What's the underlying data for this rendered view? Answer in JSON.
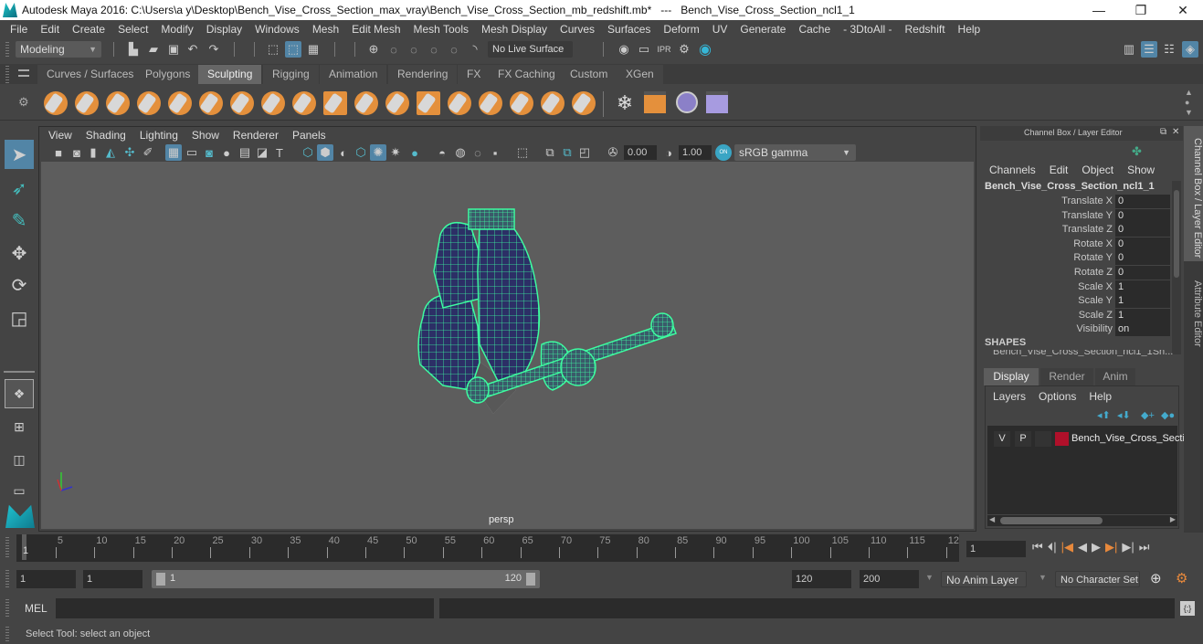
{
  "window": {
    "title": "Autodesk Maya 2016: C:\\Users\\a y\\Desktop\\Bench_Vise_Cross_Section_max_vray\\Bench_Vise_Cross_Section_mb_redshift.mb*   ---   Bench_Vise_Cross_Section_ncl1_1",
    "minimize": "—",
    "maximize": "❐",
    "close": "✕"
  },
  "menubar": [
    "File",
    "Edit",
    "Create",
    "Select",
    "Modify",
    "Display",
    "Windows",
    "Mesh",
    "Edit Mesh",
    "Mesh Tools",
    "Mesh Display",
    "Curves",
    "Surfaces",
    "Deform",
    "UV",
    "Generate",
    "Cache",
    "- 3DtoAll -",
    "Redshift",
    "Help"
  ],
  "statusline": {
    "mode": "Modeling",
    "live_surface": "No Live Surface"
  },
  "shelf": {
    "tabs": [
      "Curves / Surfaces",
      "Polygons",
      "Sculpting",
      "Rigging",
      "Animation",
      "Rendering",
      "FX",
      "FX Caching",
      "Custom",
      "XGen"
    ],
    "active_tab": "Sculpting",
    "icons": [
      "sculpt-tool",
      "smooth-tool",
      "relax-tool",
      "grab-tool",
      "pinch-tool",
      "flatten-tool",
      "foamy-tool",
      "spray-tool",
      "repeat-tool",
      "imprint-tool",
      "wax-tool",
      "scrape-tool",
      "fill-tool",
      "knife-tool",
      "smear-tool",
      "bulge-tool",
      "amplify-tool",
      "freeze-tool",
      "convert-to-frozen",
      "sculpt-settings",
      "mesh-blend",
      "sculpt-layer-editor"
    ]
  },
  "toolbox": [
    "select-tool",
    "lasso-tool",
    "paint-select-tool",
    "move-tool",
    "rotate-tool",
    "scale-tool"
  ],
  "viewport": {
    "menu": [
      "View",
      "Shading",
      "Lighting",
      "Show",
      "Renderer",
      "Panels"
    ],
    "exposure": "0.00",
    "gamma": "1.00",
    "color_space": "sRGB gamma",
    "camera_label": "persp",
    "axis": {
      "x": "x",
      "y": "y",
      "z": "z"
    }
  },
  "channel_box": {
    "header": "Channel Box / Layer Editor",
    "menu": [
      "Channels",
      "Edit",
      "Object",
      "Show"
    ],
    "object_name": "Bench_Vise_Cross_Section_ncl1_1",
    "channels": [
      {
        "label": "Translate X",
        "value": "0"
      },
      {
        "label": "Translate Y",
        "value": "0"
      },
      {
        "label": "Translate Z",
        "value": "0"
      },
      {
        "label": "Rotate X",
        "value": "0"
      },
      {
        "label": "Rotate Y",
        "value": "0"
      },
      {
        "label": "Rotate Z",
        "value": "0"
      },
      {
        "label": "Scale X",
        "value": "1"
      },
      {
        "label": "Scale Y",
        "value": "1"
      },
      {
        "label": "Scale Z",
        "value": "1"
      },
      {
        "label": "Visibility",
        "value": "on"
      }
    ],
    "shapes_label": "SHAPES",
    "shapes_item": "Bench_Vise_Cross_Section_ncl1_1Sh..."
  },
  "layer_editor": {
    "tabs": [
      "Display",
      "Render",
      "Anim"
    ],
    "active_tab": "Display",
    "menu": [
      "Layers",
      "Options",
      "Help"
    ],
    "layers": [
      {
        "v": "V",
        "p": "P",
        "color": "#b0102a",
        "name": "Bench_Vise_Cross_Section"
      }
    ]
  },
  "side_tabs": [
    "Channel Box / Layer Editor",
    "Attribute Editor"
  ],
  "timeline": {
    "ticks": [
      "5",
      "10",
      "15",
      "20",
      "25",
      "30",
      "35",
      "40",
      "45",
      "50",
      "55",
      "60",
      "65",
      "70",
      "75",
      "80",
      "85",
      "90",
      "95",
      "100",
      "105",
      "110",
      "115",
      "12"
    ],
    "current_marker": "1",
    "current_frame": "1"
  },
  "range": {
    "start": "1",
    "anim_start": "1",
    "slider_start": "1",
    "slider_end": "120",
    "anim_end": "120",
    "end": "200",
    "anim_layer": "No Anim Layer",
    "character_set": "No Character Set"
  },
  "command": {
    "label": "MEL"
  },
  "help_line": "Select Tool: select an object",
  "colors": {
    "accent": "#5285a6",
    "wireframe": "#3dfca0",
    "mesh_fill": "#2c2f66",
    "viewport_bg": "#5d5d5d",
    "shelf_orange": "#e4903c"
  }
}
